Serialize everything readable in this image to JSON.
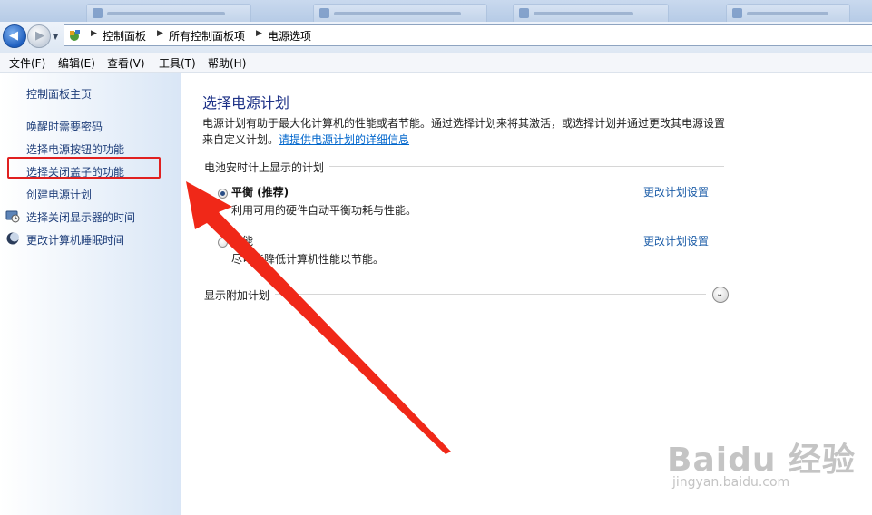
{
  "breadcrumb": {
    "items": [
      "控制面板",
      "所有控制面板项",
      "电源选项"
    ]
  },
  "menubar": {
    "items": [
      "文件(F)",
      "编辑(E)",
      "查看(V)",
      "工具(T)",
      "帮助(H)"
    ]
  },
  "left_pane": {
    "home": "控制面板主页",
    "links": [
      "唤醒时需要密码",
      "选择电源按钮的功能",
      "选择关闭盖子的功能",
      "创建电源计划",
      "选择关闭显示器的时间",
      "更改计算机睡眠时间"
    ]
  },
  "main": {
    "title": "选择电源计划",
    "desc_line1": "电源计划有助于最大化计算机的性能或者节能。通过选择计划来将其激活，或选择计划并通过更改其电源设置",
    "desc_line2_prefix": "来自定义计划。",
    "desc_link": "请提供电源计划的详细信息",
    "section_battery": "电池安时计上显示的计划",
    "plans": [
      {
        "name": "平衡 (推荐)",
        "desc": "利用可用的硬件自动平衡功耗与性能。",
        "link": "更改计划设置",
        "selected": true
      },
      {
        "name": "节能",
        "desc": "尽可能降低计算机性能以节能。",
        "link": "更改计划设置",
        "selected": false
      }
    ],
    "section_more": "显示附加计划"
  },
  "watermark": {
    "logo": "Baidu 经验",
    "sub": "jingyan.baidu.com"
  },
  "colors": {
    "link": "#1e5ea8",
    "title": "#1e3287",
    "annotation": "#e02020"
  }
}
